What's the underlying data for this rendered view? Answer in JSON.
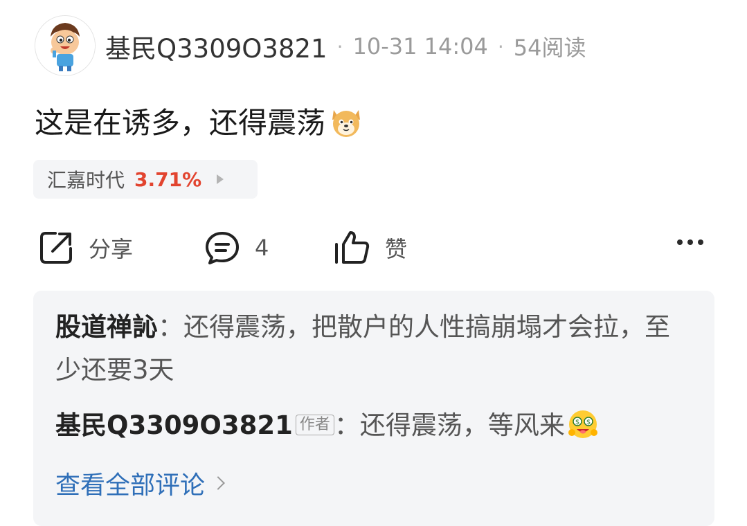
{
  "post": {
    "username": "基民Q3309O3821",
    "time": "10-31 14:04",
    "read_count": "54阅读",
    "separator": "·",
    "text": "这是在诱多，还得震荡"
  },
  "stock": {
    "name": "汇嘉时代",
    "change": "3.71%",
    "change_color": "#e2442f"
  },
  "actions": {
    "share_label": "分享",
    "comment_count": "4",
    "like_label": "赞"
  },
  "comments": [
    {
      "author": "股道禅訫",
      "colon": "：",
      "text": "还得震荡，把散户的人性搞崩塌才会拉，至少还要3天"
    },
    {
      "author": "基民Q3309O3821",
      "tag": "作者",
      "colon": "：",
      "text": "还得震荡，等风来"
    }
  ],
  "view_all_label": "查看全部评论",
  "icons": [
    "avatar-cartoon-boy",
    "dog-face-emoji",
    "share-icon",
    "comment-icon",
    "thumbs-up-icon",
    "more-icon",
    "money-face-emoji",
    "chevron-right-icon"
  ]
}
